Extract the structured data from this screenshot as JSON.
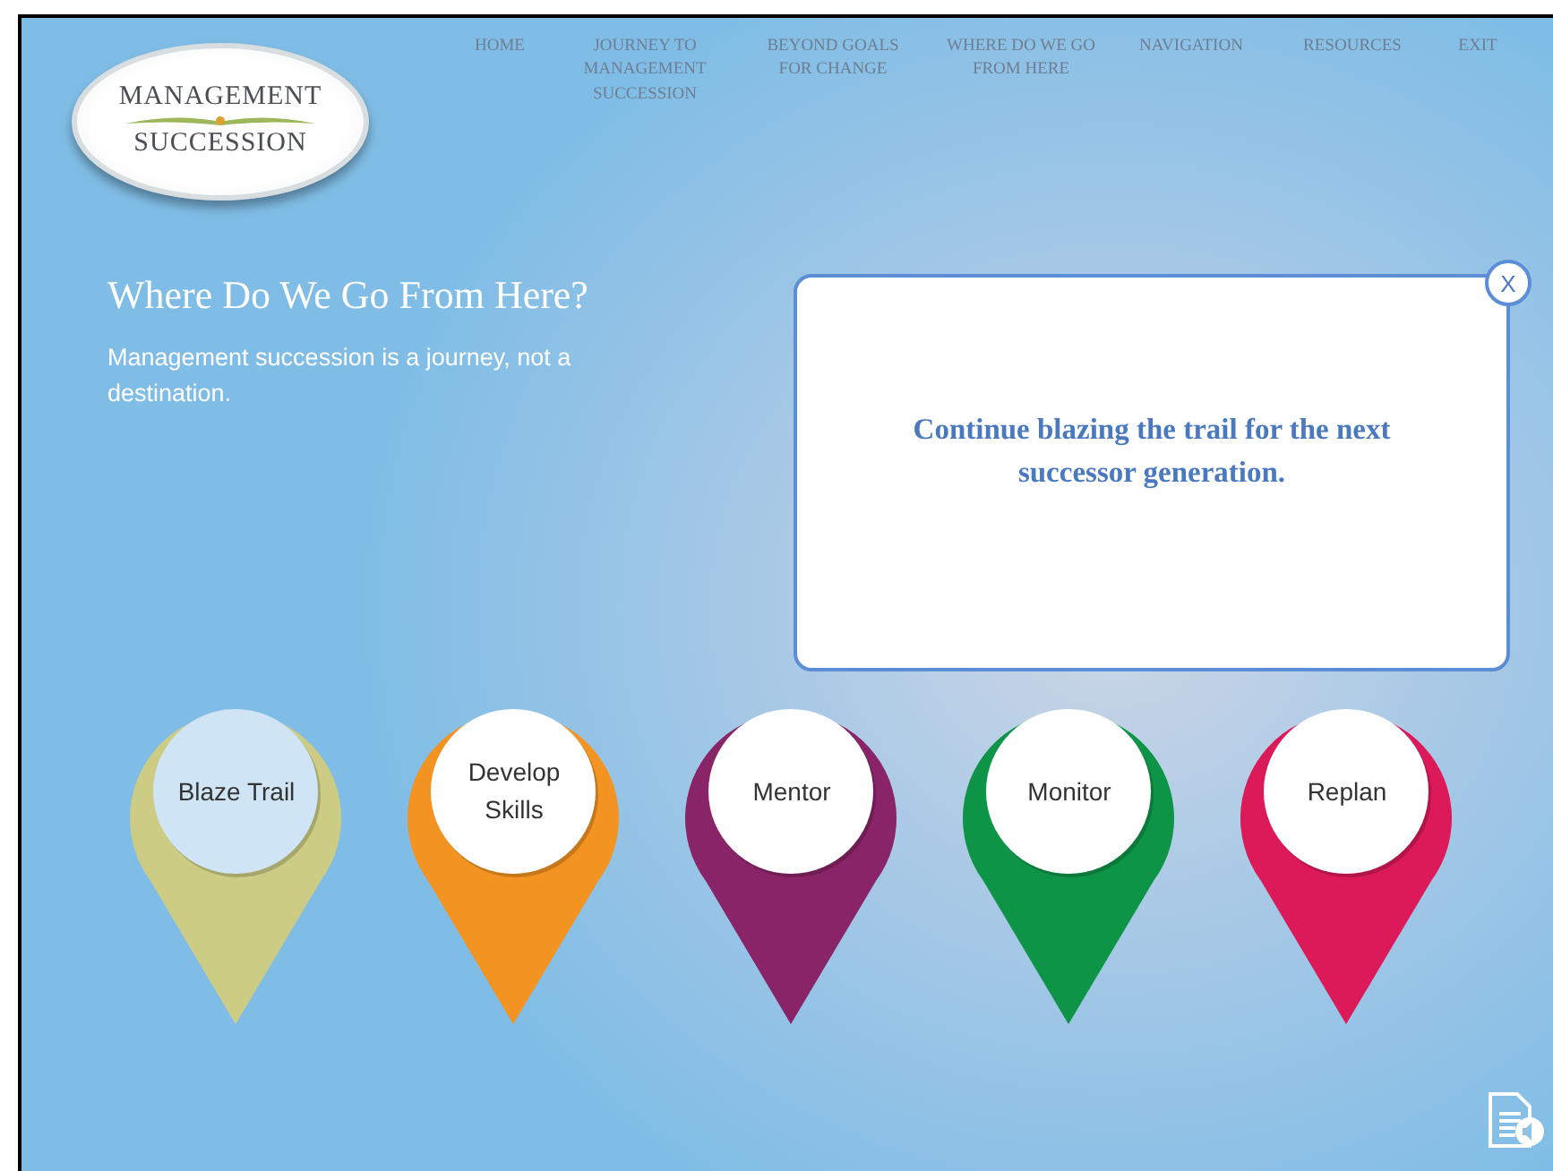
{
  "logo": {
    "line_1": "MANAGEMENT",
    "line_2": "SUCCESSION"
  },
  "nav": [
    {
      "label": "HOME"
    },
    {
      "label": "JOURNEY TO MANAGEMENT SUCCESSION"
    },
    {
      "label": "BEYOND GOALS FOR CHANGE"
    },
    {
      "label": "WHERE DO WE GO FROM HERE"
    },
    {
      "label": "NAVIGATION"
    },
    {
      "label": "RESOURCES"
    },
    {
      "label": "EXIT"
    }
  ],
  "heading": "Where Do We Go From Here?",
  "intro": "Management succession is a journey, not a destination.",
  "dialog": {
    "close": "X",
    "message": "Continue blazing the trail for the next successor generation."
  },
  "pins": [
    {
      "label": "Blaze Trail",
      "color": "#cccc84",
      "selected": true
    },
    {
      "label": "Develop Skills",
      "color": "#f39322",
      "selected": false
    },
    {
      "label": "Mentor",
      "color": "#8a2468",
      "selected": false
    },
    {
      "label": "Monitor",
      "color": "#0d9446",
      "selected": false
    },
    {
      "label": "Replan",
      "color": "#dc1a5a",
      "selected": false
    }
  ]
}
